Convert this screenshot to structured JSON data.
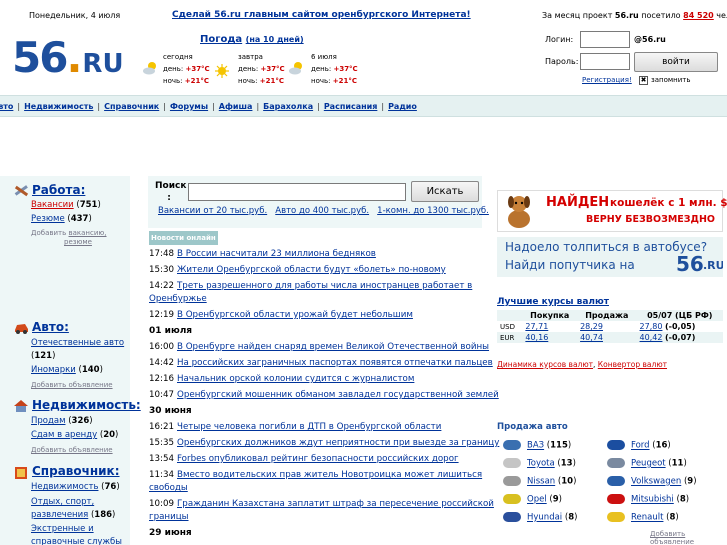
{
  "topbar": {
    "date": "Понедельник, 4 июля",
    "promo": "Сделай 56.ru главным сайтом оренбургского Интернета!",
    "visitors_prefix": "За месяц проект",
    "visitors_site": "56.ru",
    "visitors_mid": "посетило",
    "visitors_count": "84 520",
    "visitors_suffix": "человек"
  },
  "logo": {
    "number": "56",
    "dot": ".",
    "tld": "RU"
  },
  "weather": {
    "title": "Погода",
    "link": "(на 10 дней)",
    "days": [
      {
        "name": "сегодня",
        "day_label": "день:",
        "day_temp": "+37°C",
        "night_label": "ночь:",
        "night_temp": "+21°C"
      },
      {
        "name": "завтра",
        "day_label": "день:",
        "day_temp": "+37°C",
        "night_label": "ночь:",
        "night_temp": "+21°C"
      },
      {
        "name": "6 июля",
        "day_label": "день:",
        "day_temp": "+37°C",
        "night_label": "ночь:",
        "night_temp": "+21°C"
      }
    ]
  },
  "login": {
    "login_label": "Логин:",
    "domain": "@56.ru",
    "password_label": "Пароль:",
    "submit": "войти",
    "register": "Регистрация!",
    "remember": "запомнить"
  },
  "nav": [
    "Авто",
    "Недвижимость",
    "Справочник",
    "Форумы",
    "Афиша",
    "Барахолка",
    "Расписания",
    "Радио"
  ],
  "left": {
    "job": {
      "title": "Работа:",
      "items": [
        {
          "label": "Вакансии",
          "count": "751",
          "red": true
        },
        {
          "label": "Резюме",
          "count": "437",
          "red": false
        }
      ],
      "add_prefix": "Добавить",
      "add_link1": "вакансию,",
      "add_link2": "резюме"
    },
    "auto": {
      "title": "Авто:",
      "items": [
        {
          "label": "Отечественные авто",
          "count": "121"
        },
        {
          "label": "Иномарки",
          "count": "140"
        }
      ],
      "add": "Добавить объявление"
    },
    "realty": {
      "title": "Недвижимость:",
      "items": [
        {
          "label": "Продам",
          "count": "326"
        },
        {
          "label": "Сдам в аренду",
          "count": "20"
        }
      ],
      "add": "Добавить объявление"
    },
    "directory": {
      "title": "Справочник:",
      "items": [
        {
          "label": "Недвижимость",
          "count": "76"
        },
        {
          "label": "Отдых, спорт, развлечения",
          "count": "186"
        },
        {
          "label": "Экстренные и справочные службы",
          "count": ""
        }
      ]
    }
  },
  "search": {
    "label": "Поиск :",
    "button": "Искать",
    "hints": [
      "Вакансии от 20 тыс.руб.",
      "Авто до 400 тыс.руб.",
      "1-комн. до 1300 тыс.руб."
    ]
  },
  "news": {
    "badge": "Новости онлайн",
    "rows": [
      {
        "type": "item",
        "time": "17:48",
        "text": "В России насчитали 23 миллиона бедняков"
      },
      {
        "type": "item",
        "time": "15:30",
        "text": "Жители Оренбургской области будут «болеть» по-новому"
      },
      {
        "type": "item",
        "time": "14:22",
        "text": "Треть разрешенного для работы числа иностранцев работает в",
        "text2": "Оренбуржье"
      },
      {
        "type": "item",
        "time": "12:19",
        "text": "В Оренбургской области урожай будет небольшим"
      },
      {
        "type": "date",
        "text": "01 июля"
      },
      {
        "type": "item",
        "time": "16:00",
        "text": "В Оренбурге найден снаряд времен Великой Отечественной войны"
      },
      {
        "type": "item",
        "time": "14:42",
        "text": "На российских заграничных паспортах появятся отпечатки пальцев"
      },
      {
        "type": "item",
        "time": "12:16",
        "text": "Начальник орской колонии судится с журналистом"
      },
      {
        "type": "item",
        "time": "10:47",
        "text": "Оренбургский мошенник обманом завладел государственной землей"
      },
      {
        "type": "date",
        "text": "30 июня"
      },
      {
        "type": "item",
        "time": "16:21",
        "text": "Четыре человека погибли в ДТП в Оренбургской области"
      },
      {
        "type": "item",
        "time": "15:35",
        "text": "Оренбургских должников ждут неприятности при выезде за границу"
      },
      {
        "type": "item",
        "time": "13:54",
        "text": "Forbes опубликовал рейтинг безопасности российских дорог"
      },
      {
        "type": "item",
        "time": "11:34",
        "text": "Вместо водительских прав житель Новотроицка может лишиться",
        "text2": "свободы"
      },
      {
        "type": "item",
        "time": "10:09",
        "text": "Гражданин Казахстана заплатит штраф за пересечение российской",
        "text2": "границы"
      },
      {
        "type": "date",
        "text": "29 июня"
      }
    ]
  },
  "banners": {
    "found": "НАЙДЕН",
    "found_rest": "кошелёк с 1 млн. $",
    "found_sub": "ВЕРНУ БЕЗВОЗМЕЗДНО",
    "bus_line1": "Надоело толпиться в автобусе?",
    "bus_line2": "Найди попутчика на",
    "bus_brand": "56",
    "bus_tld": ".RU"
  },
  "rates": {
    "title": "Лучшие курсы валют",
    "headers": [
      "",
      "Покупка",
      "Продажа",
      "05/07 (ЦБ РФ)"
    ],
    "rows": [
      {
        "cur": "USD",
        "buy": "27,71",
        "sell": "28,29",
        "cb": "27,80",
        "diff": "(-0,05)"
      },
      {
        "cur": "EUR",
        "buy": "40,16",
        "sell": "40,74",
        "cb": "40,42",
        "diff": "(-0,07)"
      }
    ],
    "link1": "Динамика курсов валют",
    "link2": "Конвертор валют"
  },
  "autosale": {
    "title": "Продажа авто",
    "left": [
      {
        "name": "ВАЗ",
        "count": "115"
      },
      {
        "name": "Toyota",
        "count": "13"
      },
      {
        "name": "Nissan",
        "count": "10"
      },
      {
        "name": "Opel",
        "count": "9"
      },
      {
        "name": "Hyundai",
        "count": "8"
      }
    ],
    "right": [
      {
        "name": "Ford",
        "count": "16"
      },
      {
        "name": "Peugeot",
        "count": "11"
      },
      {
        "name": "Volkswagen",
        "count": "9"
      },
      {
        "name": "Mitsubishi",
        "count": "8"
      },
      {
        "name": "Renault",
        "count": "8"
      }
    ],
    "add": "Добавить объявление"
  },
  "colors": {
    "brand_blue": "#1e4f9c",
    "red": "#cc0000",
    "panel_bg": "#eef7f7",
    "nav_bg": "#e5f1f1"
  }
}
